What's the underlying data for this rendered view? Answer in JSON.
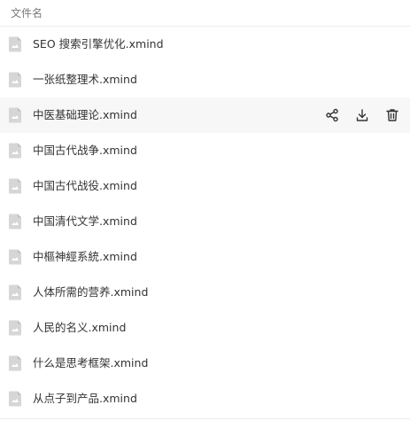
{
  "header": {
    "column_label": "文件名"
  },
  "files": [
    {
      "name": "SEO 搜索引擎优化.xmind",
      "icon": "xmind-file-icon"
    },
    {
      "name": "一张纸整理术.xmind",
      "icon": "xmind-file-icon"
    },
    {
      "name": "中医基础理论.xmind",
      "icon": "xmind-file-icon",
      "hovered": true
    },
    {
      "name": "中国古代战争.xmind",
      "icon": "xmind-file-icon"
    },
    {
      "name": "中国古代战役.xmind",
      "icon": "xmind-file-icon"
    },
    {
      "name": "中国清代文学.xmind",
      "icon": "xmind-file-icon"
    },
    {
      "name": "中樞神經系統.xmind",
      "icon": "xmind-file-icon"
    },
    {
      "name": "人体所需的营养.xmind",
      "icon": "xmind-file-icon"
    },
    {
      "name": "人民的名义.xmind",
      "icon": "xmind-file-icon"
    },
    {
      "name": "什么是思考框架.xmind",
      "icon": "xmind-file-icon"
    },
    {
      "name": "从点子到产品.xmind",
      "icon": "xmind-file-icon"
    }
  ],
  "row_actions": [
    {
      "icon": "share-icon"
    },
    {
      "icon": "download-icon"
    },
    {
      "icon": "trash-icon"
    }
  ],
  "colors": {
    "row_hover_bg": "#f7f7f8",
    "file_icon": "#d6d6d8",
    "action_icon": "#333333"
  }
}
